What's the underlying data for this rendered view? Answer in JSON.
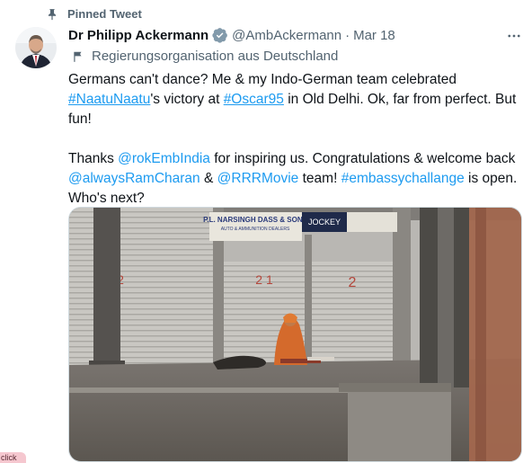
{
  "pinned": {
    "label": "Pinned Tweet",
    "icon": "pin-icon"
  },
  "author": {
    "name": "Dr Philipp Ackermann",
    "verified_icon": "verified-badge-icon",
    "handle": "@AmbAckermann",
    "separator": "·",
    "date": "Mar 18",
    "affiliation": "Regierungsorganisation aus Deutschland",
    "affiliation_icon": "flag-icon"
  },
  "more_icon": "more-dots-icon",
  "tweet": {
    "p1_a": "Germans can't dance? Me & my Indo-German team celebrated ",
    "p1_tag1": "#NaatuNaatu",
    "p1_b": "'s victory at ",
    "p1_tag2": "#Oscar95",
    "p1_c": " in Old Delhi. Ok, far from perfect. But fun!",
    "p2_a": "Thanks ",
    "p2_m1": "@rokEmbIndia",
    "p2_b": " for inspiring us. Congratulations & welcome back ",
    "p2_m2": "@alwaysRamCharan",
    "p2_c": " & ",
    "p2_m3": "@RRRMovie",
    "p2_d": " team! ",
    "p2_tag": "#embassychallange",
    "p2_e": " is open. Who's next?"
  },
  "media": {
    "sign_main": "P.L. NARSINGH DASS & SONS",
    "sign_sub": "AUTO & AMMUNITION DEALERS",
    "sign_brand": "JOCKEY",
    "shutter_numbers": [
      "2",
      "2 1",
      "2"
    ]
  },
  "overlay_tag": "click",
  "colors": {
    "link": "#1d9bf0",
    "muted": "#536471",
    "text": "#0f1419"
  }
}
